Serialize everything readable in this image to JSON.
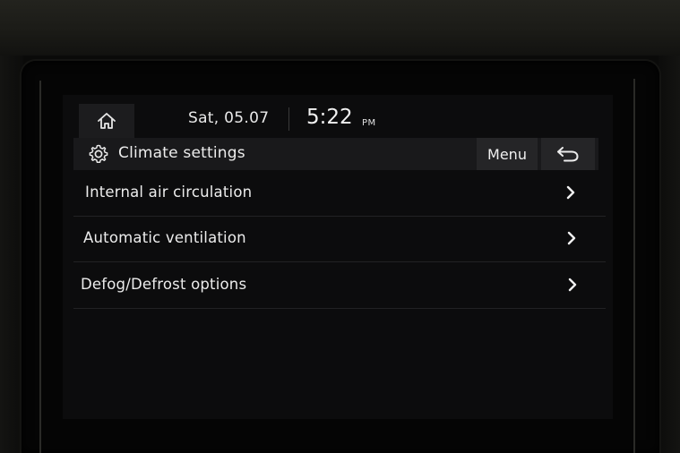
{
  "status_bar": {
    "home_icon": "home-icon",
    "date": "Sat, 05.07",
    "time": "5:22",
    "ampm": "PM"
  },
  "header": {
    "settings_icon": "gear-icon",
    "title": "Climate settings",
    "menu_label": "Menu",
    "back_icon": "back-arrow-icon"
  },
  "settings_list": [
    {
      "label": "Internal air circulation",
      "icon": "chevron-right-icon"
    },
    {
      "label": "Automatic ventilation",
      "icon": "chevron-right-icon"
    },
    {
      "label": "Defog/Defrost options",
      "icon": "chevron-right-icon"
    }
  ],
  "colors": {
    "screen_background": "#0c0c0d",
    "header_background": "#19191b",
    "button_background": "#252527",
    "text": "#ececec"
  }
}
